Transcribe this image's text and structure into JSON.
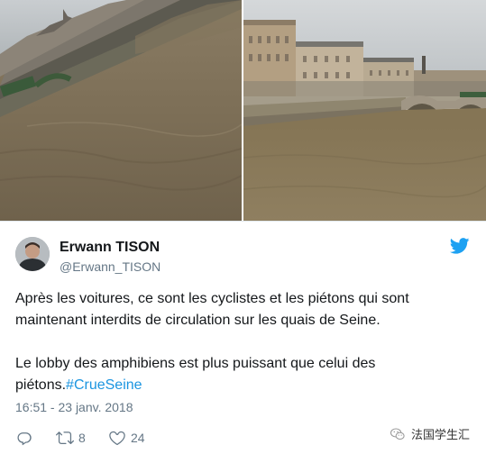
{
  "photos": [
    {
      "name": "photo-flooded-seine-left",
      "icon": "photo-flood-quay"
    },
    {
      "name": "photo-flooded-seine-right",
      "icon": "photo-flood-bridge"
    }
  ],
  "tweet": {
    "display_name": "Erwann TISON",
    "handle": "@Erwann_TISON",
    "text_line1": "Après les voitures, ce sont les cyclistes et les piétons qui sont maintenant interdits de circulation sur les quais de Seine.",
    "text_line2_prefix": "Le lobby des amphibiens est plus puissant que celui des piétons.",
    "hashtag": "#CrueSeine",
    "timestamp": "16:51 - 23 janv. 2018",
    "retweet_count": "8",
    "like_count": "24",
    "brand_icon": "twitter-bird-icon"
  },
  "watermark": {
    "text": "法国学生汇",
    "icon": "wechat-icon"
  },
  "colors": {
    "text": "#14171a",
    "secondary": "#657786",
    "link": "#1b95e0",
    "twitter_blue": "#1da1f2"
  }
}
